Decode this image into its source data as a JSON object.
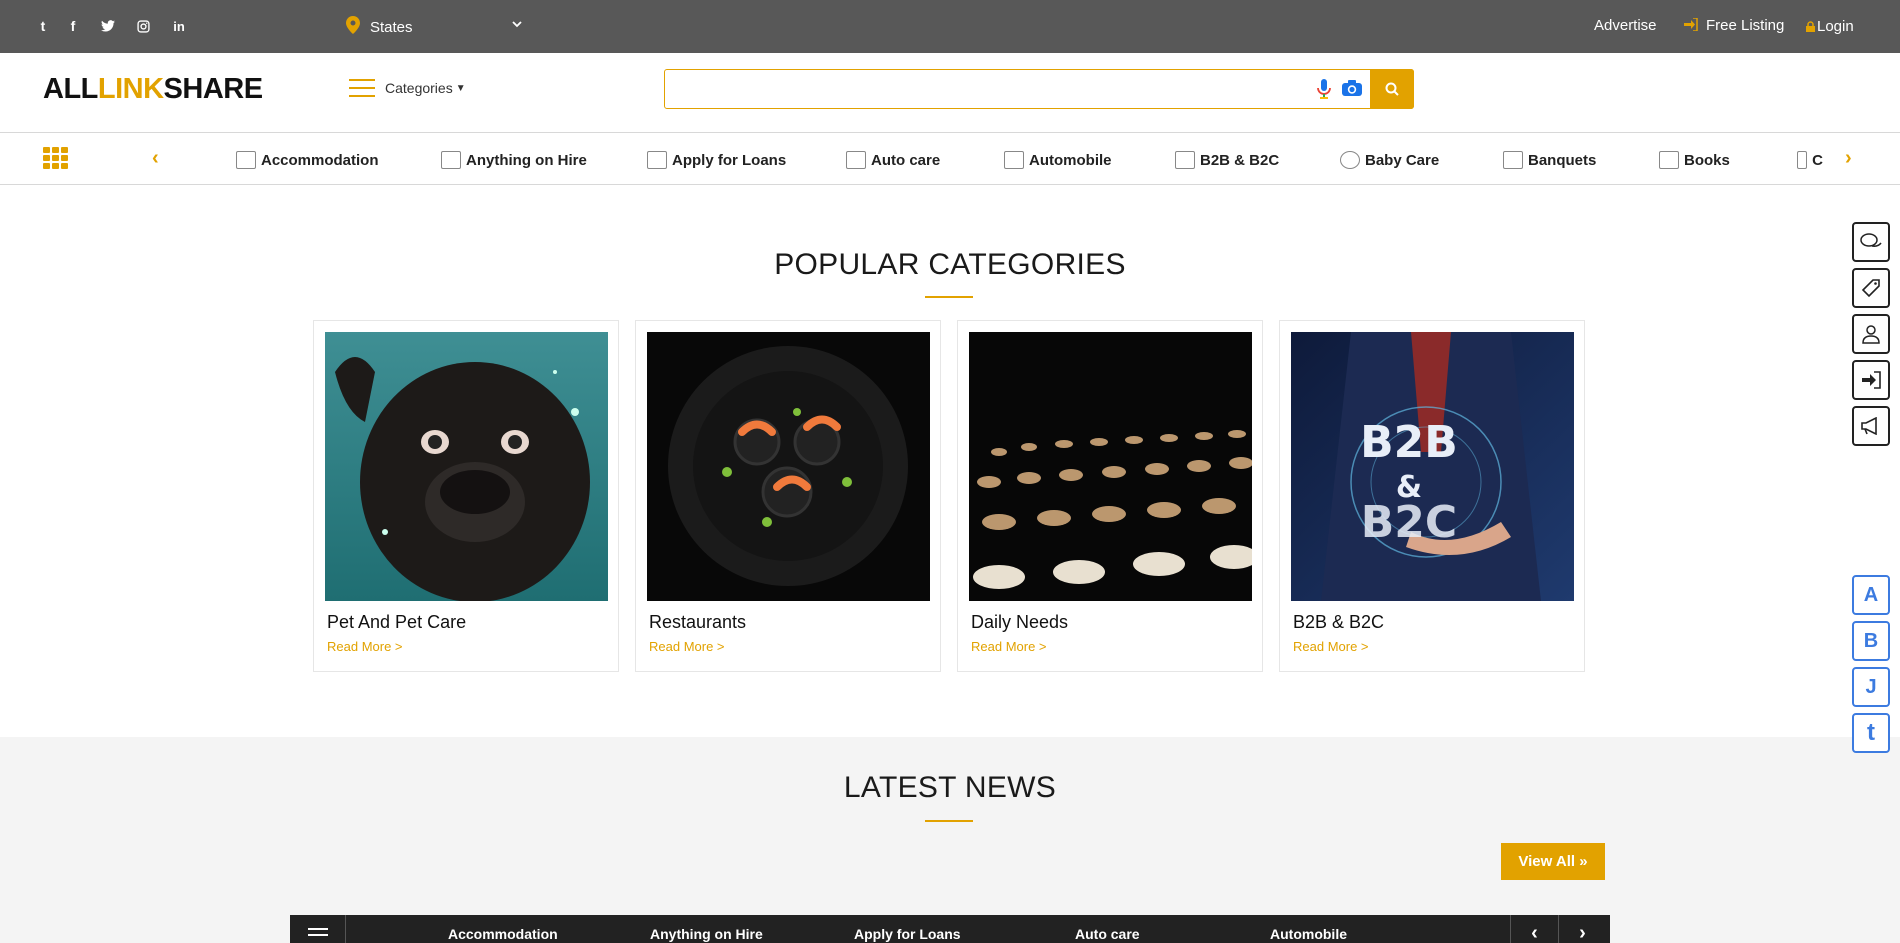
{
  "topbar": {
    "social": [
      {
        "icon": "tumblr-icon",
        "glyph": "t"
      },
      {
        "icon": "facebook-icon",
        "glyph": "f"
      },
      {
        "icon": "twitter-icon",
        "glyph": "🐦"
      },
      {
        "icon": "instagram-icon",
        "glyph": "◎"
      },
      {
        "icon": "linkedin-icon",
        "glyph": "in"
      }
    ],
    "state_select": "States",
    "advertise": "Advertise",
    "free_listing": "Free Listing",
    "login": "Login"
  },
  "header": {
    "logo": {
      "part1": "ALL",
      "part2": "LINK",
      "part3": "SHARE"
    },
    "categories_label": "Categories",
    "search": {
      "placeholder": "",
      "value": ""
    }
  },
  "category_nav": {
    "items": [
      "Accommodation",
      "Anything on Hire",
      "Apply for Loans",
      "Auto care",
      "Automobile",
      "B2B & B2C",
      "Baby Care",
      "Banquets",
      "Books",
      "C"
    ]
  },
  "popular": {
    "title": "POPULAR CATEGORIES",
    "cards": [
      {
        "title": "Pet And Pet Care",
        "link": "Read More >"
      },
      {
        "title": "Restaurants",
        "link": "Read More >"
      },
      {
        "title": "Daily Needs",
        "link": "Read More >"
      },
      {
        "title": "B2B & B2C",
        "link": "Read More >",
        "image_text_1": "B2B",
        "image_text_2": "&",
        "image_text_3": "B2C"
      }
    ]
  },
  "news": {
    "title": "LATEST NEWS",
    "view_all": "View All »",
    "tabs": [
      "Accommodation",
      "Anything on Hire",
      "Apply for Loans",
      "Auto care",
      "Automobile"
    ],
    "prev": "‹",
    "next": "›"
  },
  "side_letters": [
    "A",
    "B",
    "J",
    "t"
  ],
  "colors": {
    "accent": "#e2a200",
    "topbar": "#585858",
    "letter_blue": "#3c7be0"
  }
}
